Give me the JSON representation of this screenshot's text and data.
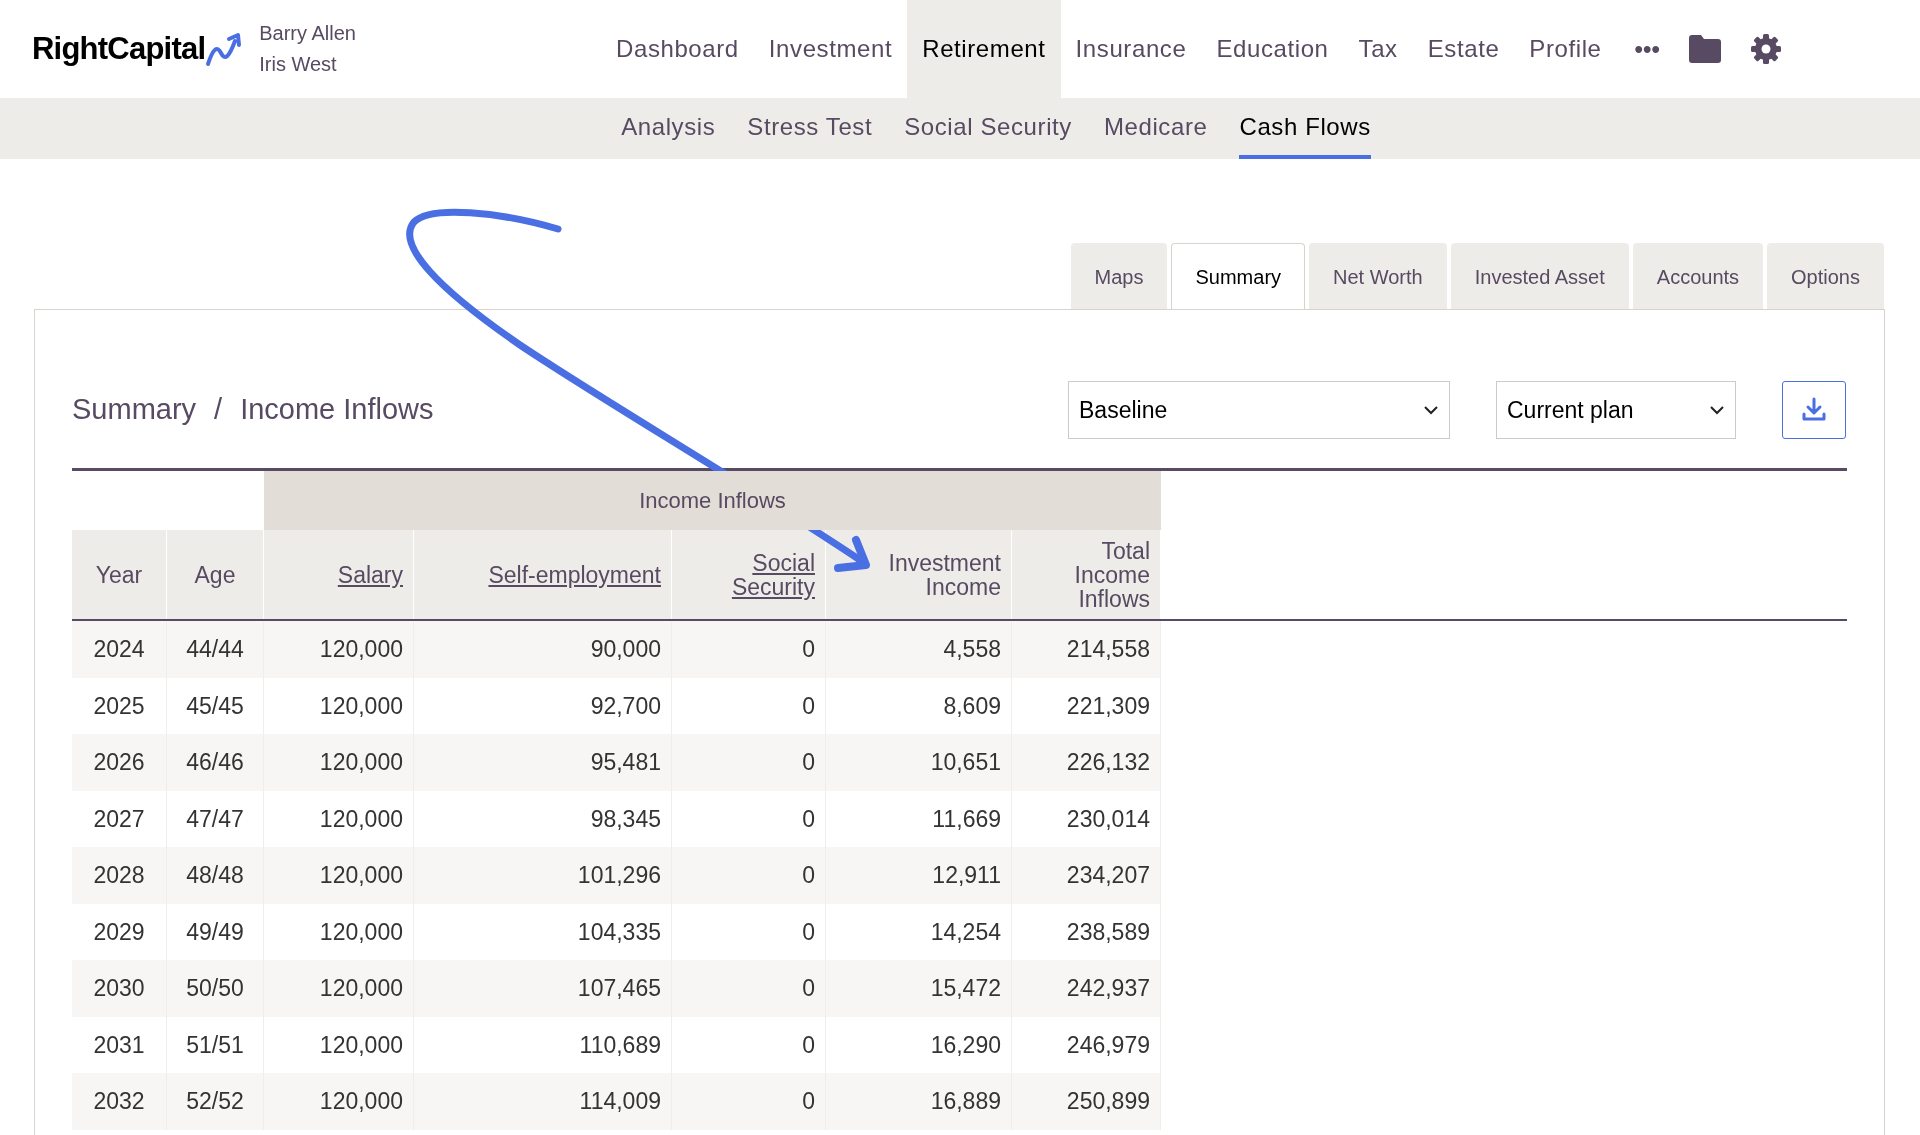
{
  "brand": {
    "logo": "RightCapital",
    "clients": [
      "Barry Allen",
      "Iris West"
    ]
  },
  "nav": [
    {
      "label": "Dashboard",
      "selected": false
    },
    {
      "label": "Investment",
      "selected": false
    },
    {
      "label": "Retirement",
      "selected": true
    },
    {
      "label": "Insurance",
      "selected": false
    },
    {
      "label": "Education",
      "selected": false
    },
    {
      "label": "Tax",
      "selected": false
    },
    {
      "label": "Estate",
      "selected": false
    },
    {
      "label": "Profile",
      "selected": false
    }
  ],
  "more": "•••",
  "subnav": [
    {
      "label": "Analysis",
      "selected": false
    },
    {
      "label": "Stress Test",
      "selected": false
    },
    {
      "label": "Social Security",
      "selected": false
    },
    {
      "label": "Medicare",
      "selected": false
    },
    {
      "label": "Cash Flows",
      "selected": true
    }
  ],
  "tabs": [
    {
      "label": "Maps",
      "selected": false
    },
    {
      "label": "Summary",
      "selected": true
    },
    {
      "label": "Net Worth",
      "selected": false
    },
    {
      "label": "Invested Asset",
      "selected": false
    },
    {
      "label": "Accounts",
      "selected": false
    },
    {
      "label": "Options",
      "selected": false
    }
  ],
  "breadcrumb": [
    "Summary",
    "Income Inflows"
  ],
  "breadcrumb_separator": "/",
  "selects": [
    {
      "value": "Baseline"
    },
    {
      "value": "Current plan"
    }
  ],
  "table": {
    "group_header": "Income Inflows",
    "columns": [
      {
        "label": "Year",
        "link": false
      },
      {
        "label": "Age",
        "link": false
      },
      {
        "label": "Salary",
        "link": true
      },
      {
        "label": "Self-employment",
        "link": true
      },
      {
        "label": "Social Security",
        "link": true
      },
      {
        "label": "Investment Income",
        "link": false
      },
      {
        "label": "Total Income Inflows",
        "link": false
      }
    ],
    "rows": [
      [
        "2024",
        "44/44",
        "120,000",
        "90,000",
        "0",
        "4,558",
        "214,558"
      ],
      [
        "2025",
        "45/45",
        "120,000",
        "92,700",
        "0",
        "8,609",
        "221,309"
      ],
      [
        "2026",
        "46/46",
        "120,000",
        "95,481",
        "0",
        "10,651",
        "226,132"
      ],
      [
        "2027",
        "47/47",
        "120,000",
        "98,345",
        "0",
        "11,669",
        "230,014"
      ],
      [
        "2028",
        "48/48",
        "120,000",
        "101,296",
        "0",
        "12,911",
        "234,207"
      ],
      [
        "2029",
        "49/49",
        "120,000",
        "104,335",
        "0",
        "14,254",
        "238,589"
      ],
      [
        "2030",
        "50/50",
        "120,000",
        "107,465",
        "0",
        "15,472",
        "242,937"
      ],
      [
        "2031",
        "51/51",
        "120,000",
        "110,689",
        "0",
        "16,290",
        "246,979"
      ],
      [
        "2032",
        "52/52",
        "120,000",
        "114,009",
        "0",
        "16,889",
        "250,899"
      ]
    ]
  }
}
